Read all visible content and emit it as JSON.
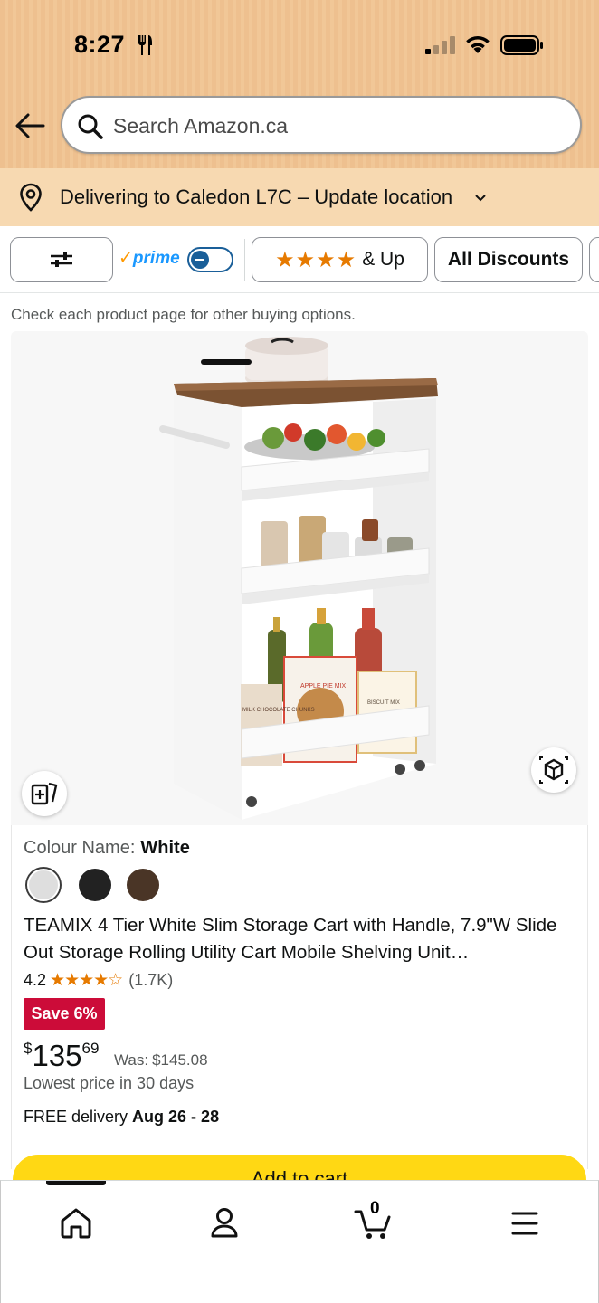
{
  "status_bar": {
    "time": "8:27"
  },
  "search": {
    "placeholder": "Search Amazon.ca"
  },
  "location": {
    "text": "Delivering to Caledon L7C – Update location"
  },
  "filters": {
    "prime_label": "prime",
    "prime_check": "✓",
    "stars_chip": {
      "stars": "★★★★",
      "label": "& Up"
    },
    "discounts_label": "All Discounts"
  },
  "notice": "Check each product page for other buying options.",
  "product": {
    "colour_label": "Colour Name:",
    "colour_value": "White",
    "swatches": [
      "White",
      "Black",
      "Brown"
    ],
    "title": "TEAMIX 4 Tier White Slim Storage Cart with Handle, 7.9\"W Slide Out Storage Rolling Utility Cart Mobile Shelving Unit…",
    "rating_value": "4.2",
    "rating_stars": "★★★★☆",
    "rating_count": "(1.7K)",
    "save_badge": "Save 6%",
    "price_symbol": "$",
    "price_whole": "135",
    "price_fraction": "69",
    "was_label": "Was:",
    "was_price": "$145.08",
    "lowest_price_note": "Lowest price in 30 days",
    "delivery_prefix": "FREE delivery ",
    "delivery_dates": "Aug 26 - 28",
    "add_to_cart": "Add to cart",
    "image_labels": {
      "box1": "APPLE PIE MIX",
      "box2": "MILK CHOCOLATE CHUNKS",
      "box3": "BISCUIT MIX"
    }
  },
  "bottom_nav": {
    "cart_count": "0",
    "items": [
      "home",
      "account",
      "cart",
      "menu"
    ]
  },
  "colors": {
    "header_bg": "#eec08f",
    "location_bg": "#f7d9b1",
    "accent_star": "#e67a00",
    "prime_blue": "#1a98ff",
    "save_red": "#cc0c39",
    "cart_yellow": "#ffd814"
  }
}
